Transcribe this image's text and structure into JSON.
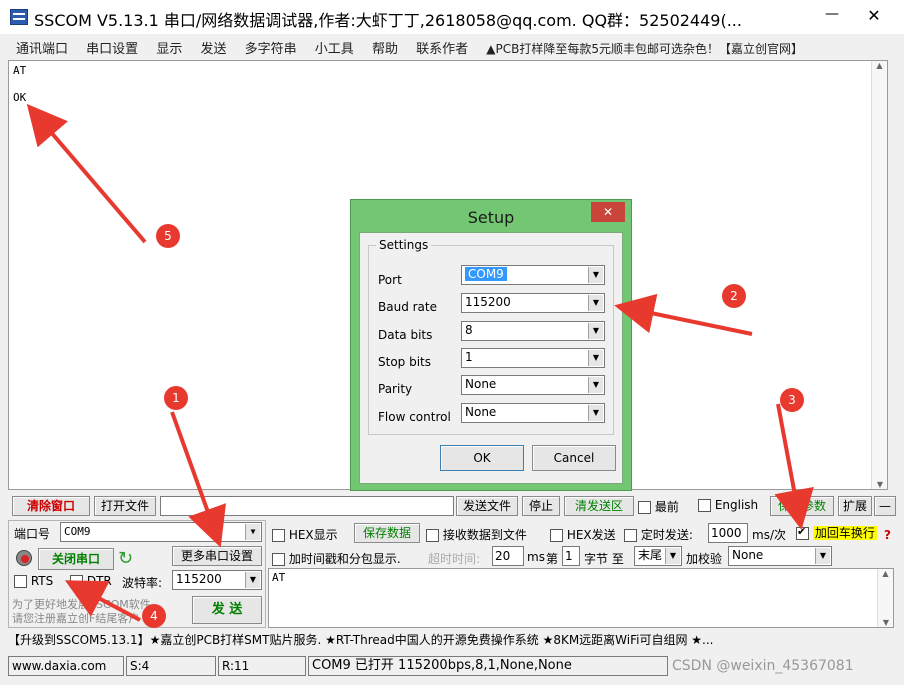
{
  "window": {
    "title": "SSCOM V5.13.1 串口/网络数据调试器,作者:大虾丁丁,2618058@qq.com. QQ群：52502449(...",
    "minimize": "—",
    "close": "✕"
  },
  "menu": {
    "items": [
      "通讯端口",
      "串口设置",
      "显示",
      "发送",
      "多字符串",
      "小工具",
      "帮助",
      "联系作者"
    ],
    "promo": "▲PCB打样降至每款5元顺丰包邮可选杂色！【嘉立创官网】"
  },
  "receive": {
    "lines": [
      "AT",
      "OK"
    ]
  },
  "setup": {
    "title": "Setup",
    "close": "✕",
    "group": "Settings",
    "fields": [
      {
        "label": "Port",
        "value": "COM9"
      },
      {
        "label": "Baud rate",
        "value": "115200"
      },
      {
        "label": "Data bits",
        "value": "8"
      },
      {
        "label": "Stop bits",
        "value": "1"
      },
      {
        "label": "Parity",
        "value": "None"
      },
      {
        "label": "Flow control",
        "value": "None"
      }
    ],
    "ok": "OK",
    "cancel": "Cancel"
  },
  "toolbar": {
    "clear": "清除窗口",
    "open_file": "打开文件",
    "send_file": "发送文件",
    "stop": "停止",
    "clear_send": "清发送区",
    "front": "最前",
    "english": "English",
    "save_params": "保存参数",
    "expand": "扩展",
    "dash": "—"
  },
  "port": {
    "port_label": "端口号",
    "port_value": "COM9",
    "close_port": "关闭串口",
    "more_settings": "更多串口设置",
    "rts": "RTS",
    "dtr": "DTR",
    "baud_label": "波特率:",
    "baud_value": "115200",
    "promo1": "为了更好地发展SSCOM软件",
    "promo2": "请您注册嘉立创F结尾客户",
    "send": "发 送"
  },
  "options": {
    "hex_show": "HEX显示",
    "save_data": "保存数据",
    "recv_to_file": "接收数据到文件",
    "hex_send": "HEX发送",
    "timed_send": "定时发送:",
    "interval": "1000",
    "unit": "ms/次",
    "add_crlf": "加回车换行",
    "help": "?",
    "timestamp": "加时间戳和分包显示.",
    "timeout_label": "超时时间:",
    "timeout_value": "20",
    "ms": "ms",
    "di": "第",
    "byte_index": "1",
    "byte_label": "字节 至",
    "tail": "末尾",
    "checksum_label": "加校验",
    "checksum_value": "None"
  },
  "send_area": {
    "text": "AT"
  },
  "ticker": "【升级到SSCOM5.13.1】★嘉立创PCB打样SMT贴片服务. ★RT-Thread中国人的开源免费操作系统 ★8KM远距离WiFi可自组网 ★...",
  "status": {
    "site": "www.daxia.com",
    "s": "S:4",
    "r": "R:11",
    "port_status": "COM9 已打开  115200bps,8,1,None,None"
  },
  "watermark": "CSDN @weixin_45367081",
  "annotations": [
    "1",
    "2",
    "3",
    "4",
    "5"
  ],
  "colors": {
    "arrow": "#e8392f",
    "green_text": "#008000",
    "red_text": "#cc0000",
    "selection": "#3399ff",
    "dialog_frame": "#5fb85f"
  }
}
